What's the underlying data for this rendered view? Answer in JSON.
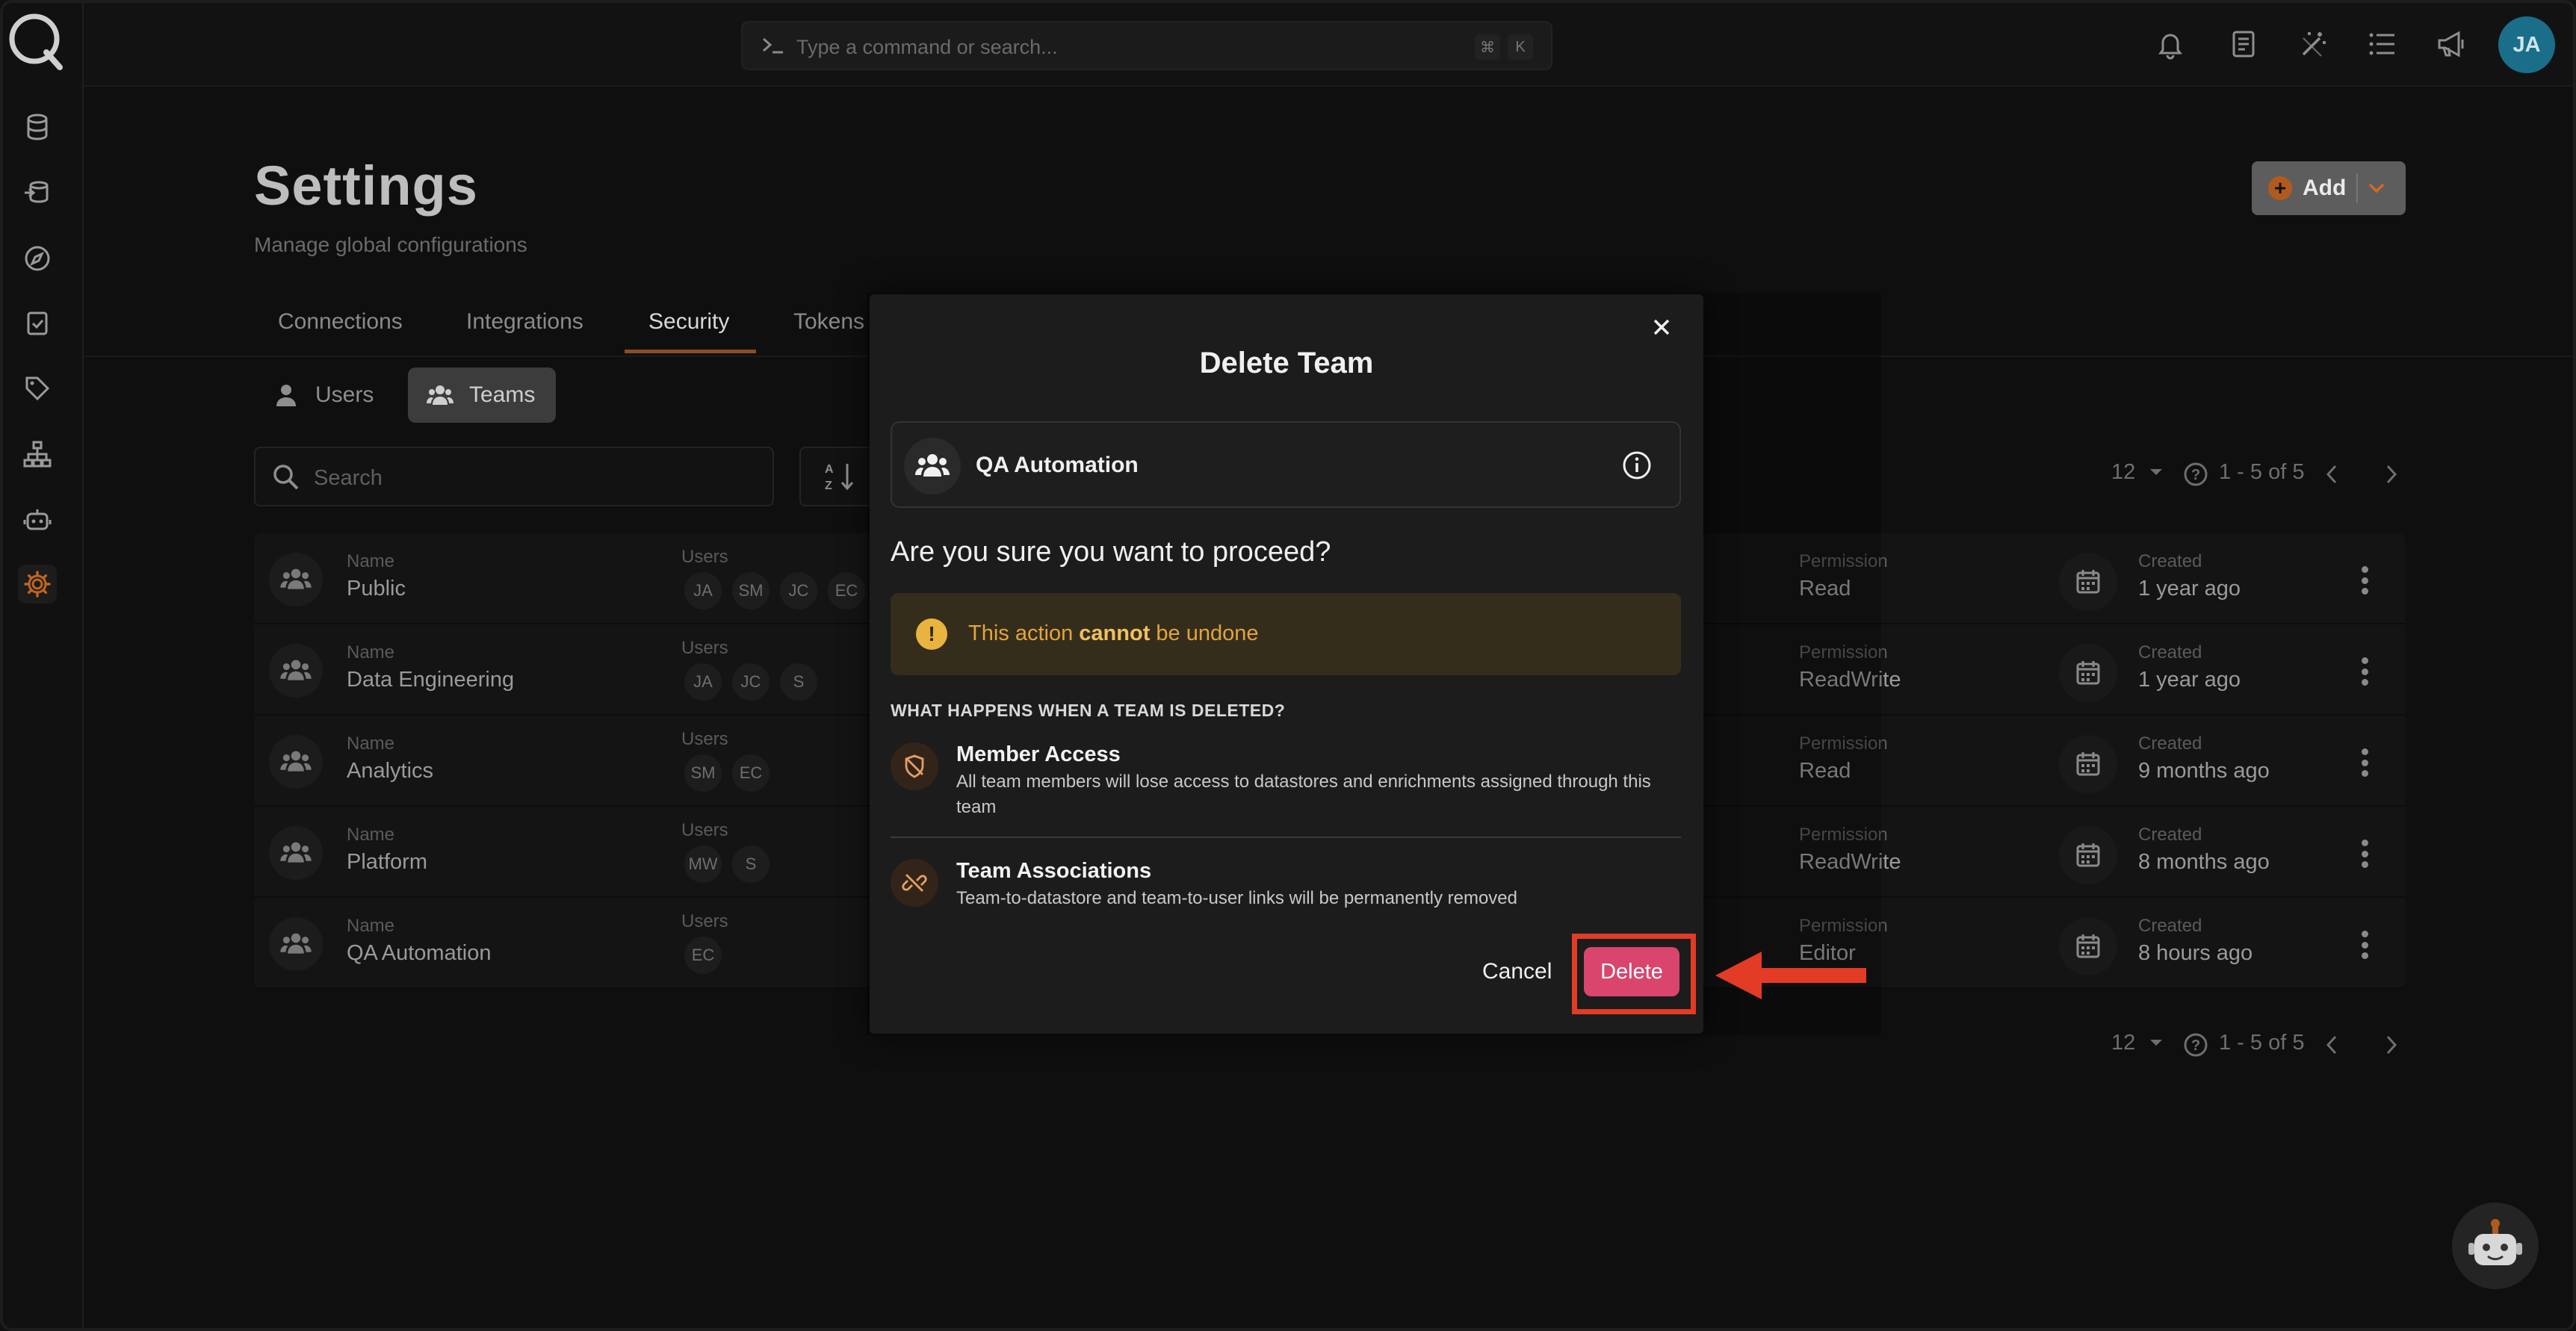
{
  "command_bar": {
    "placeholder": "Type a command or search...",
    "shortcut_mod": "⌘",
    "shortcut_key": "K"
  },
  "user": {
    "initials": "JA"
  },
  "header": {
    "title": "Settings",
    "subtitle": "Manage global configurations",
    "add_label": "Add"
  },
  "tabs": [
    {
      "label": "Connections"
    },
    {
      "label": "Integrations"
    },
    {
      "label": "Security",
      "active": true
    },
    {
      "label": "Tokens"
    }
  ],
  "subtabs": {
    "users": "Users",
    "teams": "Teams"
  },
  "search": {
    "placeholder": "Search"
  },
  "pagination": {
    "page_size": "12",
    "range": "1 - 5 of 5"
  },
  "columns": {
    "name": "Name",
    "users": "Users",
    "permission": "Permission",
    "created": "Created"
  },
  "rows": [
    {
      "name": "Public",
      "users": [
        "JA",
        "SM",
        "JC",
        "EC"
      ],
      "permission": "Read",
      "created": "1 year ago"
    },
    {
      "name": "Data Engineering",
      "users": [
        "JA",
        "JC",
        "S"
      ],
      "permission": "ReadWrite",
      "created": "1 year ago"
    },
    {
      "name": "Analytics",
      "users": [
        "SM",
        "EC"
      ],
      "permission": "Read",
      "created": "9 months ago"
    },
    {
      "name": "Platform",
      "users": [
        "MW",
        "S"
      ],
      "permission": "ReadWrite",
      "created": "8 months ago"
    },
    {
      "name": "QA Automation",
      "users": [
        "EC"
      ],
      "permission": "Editor",
      "created": "8 hours ago"
    }
  ],
  "modal": {
    "title": "Delete Team",
    "team_name": "QA Automation",
    "question": "Are you sure you want to proceed?",
    "warning_prefix": "This action ",
    "warning_bold": "cannot",
    "warning_suffix": " be undone",
    "section_heading": "WHAT HAPPENS WHEN A TEAM IS DELETED?",
    "items": [
      {
        "heading": "Member Access",
        "description": "All team members will lose access to datastores and enrichments assigned through this team"
      },
      {
        "heading": "Team Associations",
        "description": "Team-to-datastore and team-to-user links will be permanently removed"
      }
    ],
    "cancel_label": "Cancel",
    "delete_label": "Delete"
  },
  "colors": {
    "accent": "#c0641f",
    "delete": "#d9456d",
    "warning_bg": "#352d1c",
    "warning_text": "#e0a53c",
    "annotation": "#e23b26",
    "avatar": "#1a6e89"
  }
}
